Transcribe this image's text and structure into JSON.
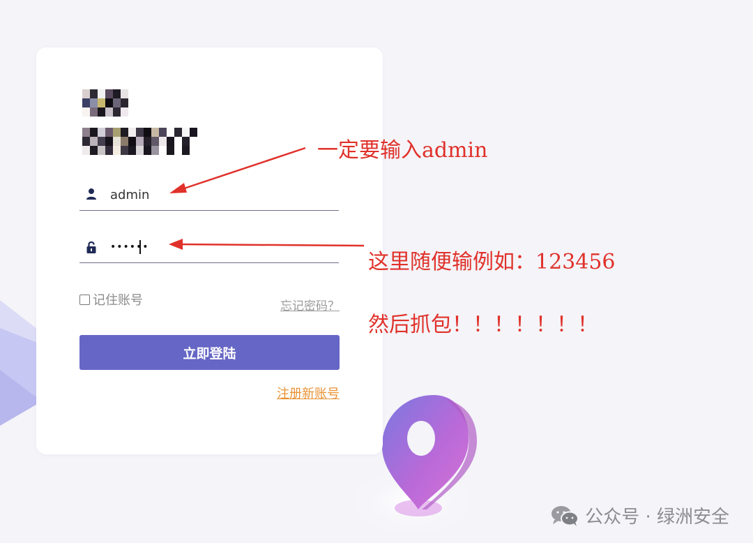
{
  "login": {
    "username_value": "admin",
    "password_value": "••••••",
    "remember_label": "记住账号",
    "forgot_label": "忘记密码？",
    "submit_label": "立即登陆",
    "register_label": "注册新账号"
  },
  "annotations": {
    "username_note": "一定要输入admin",
    "password_note": "这里随便输例如：123456",
    "capture_note": "然后抓包！！！！！！！"
  },
  "watermark": {
    "text": "公众号 · 绿洲安全",
    "icon": "wechat-icon"
  },
  "colors": {
    "accent": "#6666c6",
    "link_orange": "#e89234",
    "annotation_red": "#e0312a",
    "background": "#f4f4f9"
  }
}
